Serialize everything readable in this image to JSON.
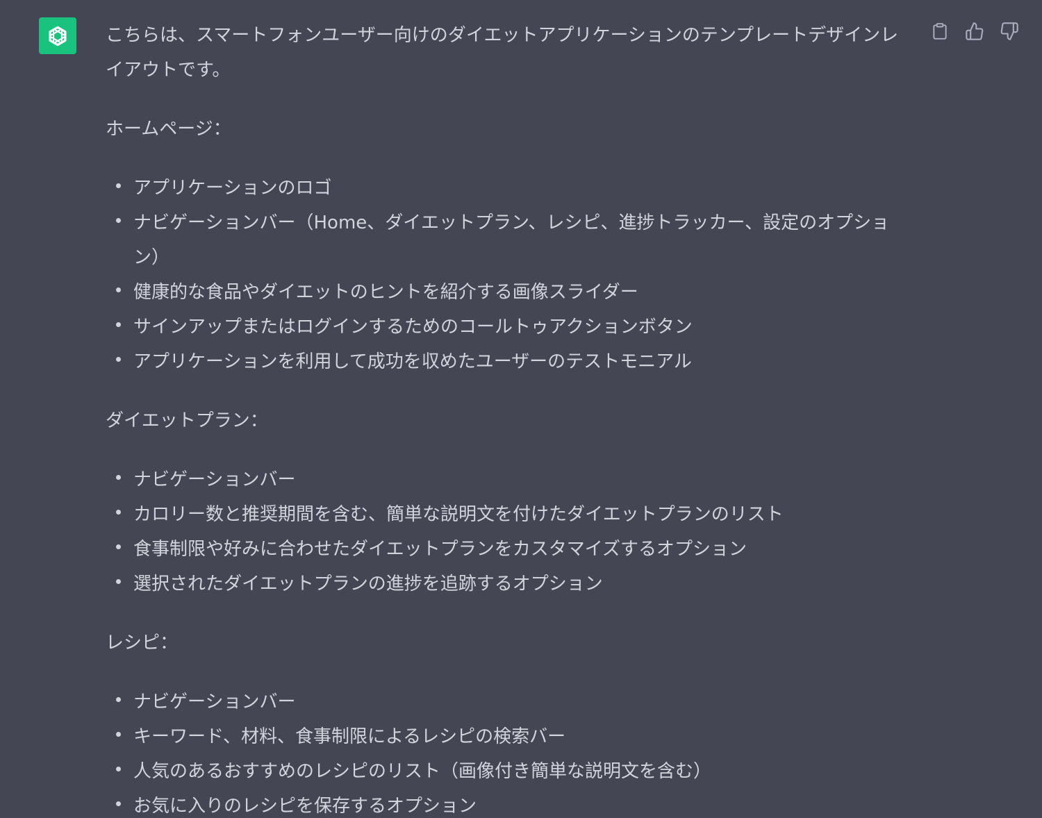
{
  "icons": {
    "avatar": "openai-logo-icon",
    "copy": "clipboard-icon",
    "like": "thumbs-up-icon",
    "dislike": "thumbs-down-icon"
  },
  "colors": {
    "background": "#444654",
    "avatar_bg": "#19c37d",
    "text": "#d1d5db",
    "icon": "#acacbe"
  },
  "message": {
    "intro": "こちらは、スマートフォンユーザー向けのダイエットアプリケーションのテンプレートデザインレイアウトです。",
    "sections": [
      {
        "title": "ホームページ：",
        "items": [
          "アプリケーションのロゴ",
          "ナビゲーションバー（Home、ダイエットプラン、レシピ、進捗トラッカー、設定のオプション）",
          "健康的な食品やダイエットのヒントを紹介する画像スライダー",
          "サインアップまたはログインするためのコールトゥアクションボタン",
          "アプリケーションを利用して成功を収めたユーザーのテストモニアル"
        ]
      },
      {
        "title": "ダイエットプラン：",
        "items": [
          "ナビゲーションバー",
          "カロリー数と推奨期間を含む、簡単な説明文を付けたダイエットプランのリスト",
          "食事制限や好みに合わせたダイエットプランをカスタマイズするオプション",
          "選択されたダイエットプランの進捗を追跡するオプション"
        ]
      },
      {
        "title": "レシピ：",
        "items": [
          "ナビゲーションバー",
          "キーワード、材料、食事制限によるレシピの検索バー",
          "人気のあるおすすめのレシピのリスト（画像付き簡単な説明文を含む）",
          "お気に入りのレシピを保存するオプション"
        ]
      }
    ]
  }
}
